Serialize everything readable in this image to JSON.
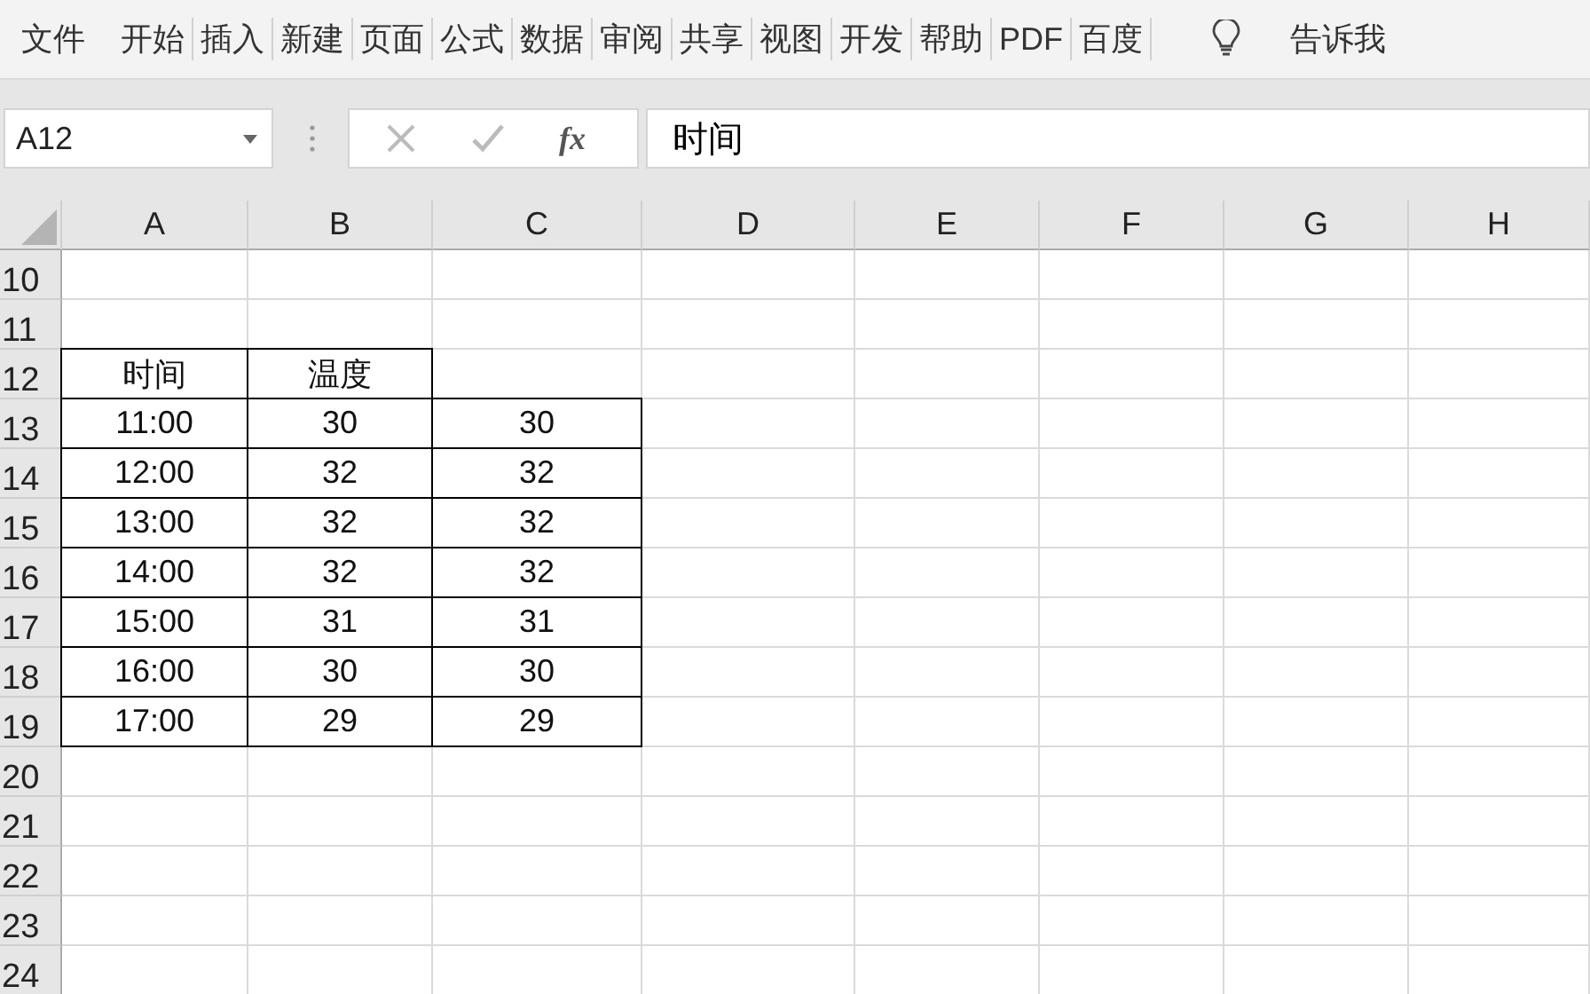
{
  "ribbon": {
    "tabs": [
      {
        "label": "文件"
      },
      {
        "label": "开始"
      },
      {
        "label": "插入"
      },
      {
        "label": "新建"
      },
      {
        "label": "页面"
      },
      {
        "label": "公式"
      },
      {
        "label": "数据"
      },
      {
        "label": "审阅"
      },
      {
        "label": "共享"
      },
      {
        "label": "视图"
      },
      {
        "label": "开发"
      },
      {
        "label": "帮助"
      },
      {
        "label": "PDF"
      },
      {
        "label": "百度"
      }
    ],
    "tell_me": "告诉我"
  },
  "formula_bar": {
    "name_box": "A12",
    "fx": "fx",
    "value": "时间"
  },
  "sheet": {
    "columns": [
      "A",
      "B",
      "C",
      "D",
      "E",
      "F",
      "G",
      "H"
    ],
    "rows": [
      {
        "number": "10"
      },
      {
        "number": "11"
      },
      {
        "number": "12",
        "cells": [
          {
            "text": "时间",
            "bordered": true
          },
          {
            "text": "温度",
            "bordered": true
          }
        ]
      },
      {
        "number": "13",
        "cells": [
          {
            "text": "11:00",
            "bordered": true
          },
          {
            "text": "30",
            "bordered": true
          },
          {
            "text": "30",
            "bordered": true
          }
        ]
      },
      {
        "number": "14",
        "cells": [
          {
            "text": "12:00",
            "bordered": true
          },
          {
            "text": "32",
            "bordered": true
          },
          {
            "text": "32",
            "bordered": true
          }
        ]
      },
      {
        "number": "15",
        "cells": [
          {
            "text": "13:00",
            "bordered": true
          },
          {
            "text": "32",
            "bordered": true
          },
          {
            "text": "32",
            "bordered": true
          }
        ]
      },
      {
        "number": "16",
        "cells": [
          {
            "text": "14:00",
            "bordered": true
          },
          {
            "text": "32",
            "bordered": true
          },
          {
            "text": "32",
            "bordered": true
          }
        ]
      },
      {
        "number": "17",
        "cells": [
          {
            "text": "15:00",
            "bordered": true
          },
          {
            "text": "31",
            "bordered": true
          },
          {
            "text": "31",
            "bordered": true
          }
        ]
      },
      {
        "number": "18",
        "cells": [
          {
            "text": "16:00",
            "bordered": true
          },
          {
            "text": "30",
            "bordered": true
          },
          {
            "text": "30",
            "bordered": true
          }
        ]
      },
      {
        "number": "19",
        "cells": [
          {
            "text": "17:00",
            "bordered": true
          },
          {
            "text": "29",
            "bordered": true
          },
          {
            "text": "29",
            "bordered": true
          }
        ]
      },
      {
        "number": "20"
      },
      {
        "number": "21"
      },
      {
        "number": "22"
      },
      {
        "number": "23"
      },
      {
        "number": "24"
      }
    ]
  }
}
